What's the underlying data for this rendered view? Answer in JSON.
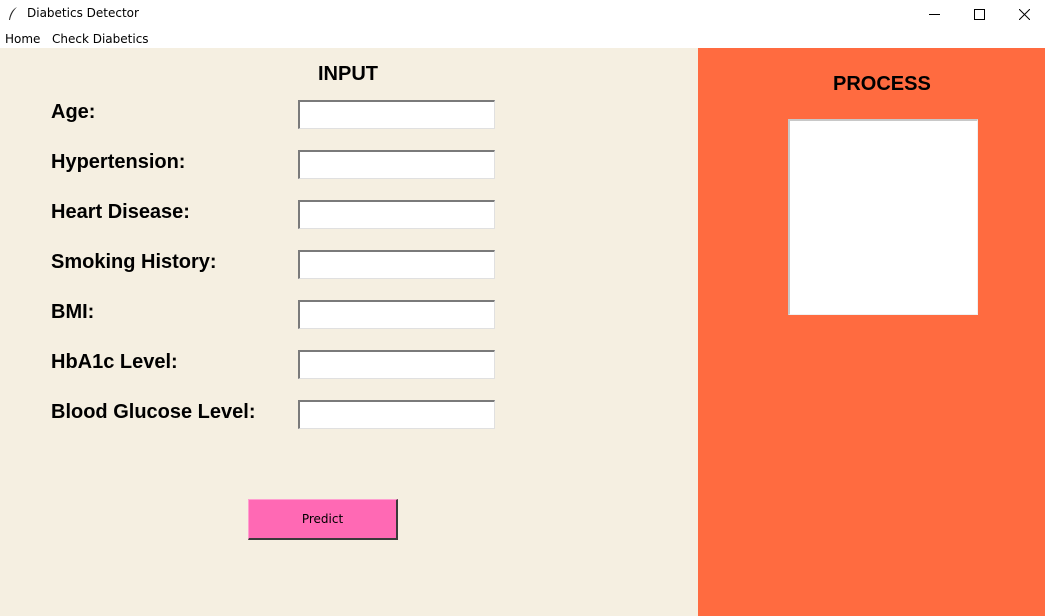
{
  "window": {
    "title": "Diabetics Detector",
    "icon": "feather-icon",
    "controls": [
      "minimize-icon",
      "maximize-icon",
      "close-icon"
    ]
  },
  "menu": {
    "items": [
      "Home",
      "Check Diabetics"
    ]
  },
  "input_panel": {
    "title": "INPUT",
    "background": "#f5efe1",
    "fields": [
      {
        "label": "Age:",
        "value": ""
      },
      {
        "label": "Hypertension:",
        "value": ""
      },
      {
        "label": "Heart Disease:",
        "value": ""
      },
      {
        "label": "Smoking History:",
        "value": ""
      },
      {
        "label": "BMI:",
        "value": ""
      },
      {
        "label": "HbA1c Level:",
        "value": ""
      },
      {
        "label": "Blood Glucose Level:",
        "value": ""
      }
    ],
    "predict_button": {
      "label": "Predict",
      "color": "#ff69b4"
    }
  },
  "process_panel": {
    "title": "PROCESS",
    "background": "#ff6b40",
    "output": ""
  }
}
